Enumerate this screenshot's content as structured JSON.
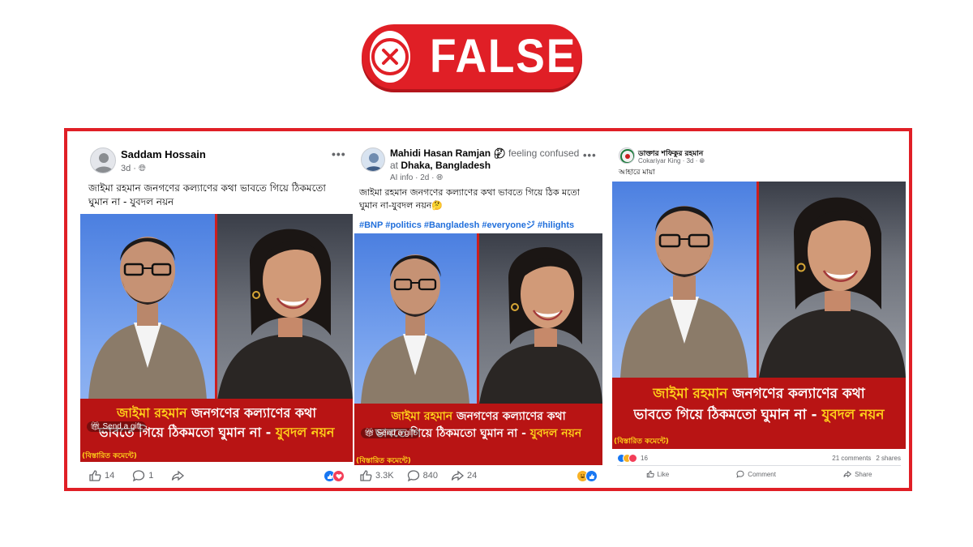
{
  "badge": {
    "label": "FALSE",
    "icon": "x-circle-icon",
    "color": "#e01f26"
  },
  "posts": [
    {
      "author": "Saddam Hossain",
      "time": "3d",
      "text": "জাইমা রহমান জনগণের কল্যাণের কথা ভাবতে গিয়ে ঠিকমতো ঘুমান না - যুবদল নয়ন",
      "caption_a": "জাইমা রহমান",
      "caption_b": " জনগণের কল্যাণের কথা",
      "caption_c": "ভাবতে গিয়ে ঠিকমতো ঘুমান না - ",
      "caption_d": "যুবদল নয়ন",
      "details": "(বিস্তারিত কমেন্টে)",
      "gift": "Send a gift",
      "likes": "14",
      "comments": "1"
    },
    {
      "author": "Mahidi Hasan Ramjan",
      "feeling": " feeling confused",
      "location_prefix": "at ",
      "location": "Dhaka, Bangladesh",
      "sub": "AI info",
      "time": "2d",
      "text": "জাইমা রহমান জনগণের কল্যাণের কথা ভাবতে  গিয়ে ঠিক মতো ঘুমান না-যুবদল নয়ন🤔",
      "tags": "#BNP #politics #Bangladesh #everyoneジ #hilights",
      "caption_a": "জাইমা রহমান",
      "caption_b": " জনগণের কল্যাণের কথা",
      "caption_c": "ভাবতে গিয়ে ঠিকমতো ঘুমান না - ",
      "caption_d": "যুবদল নয়ন",
      "details": "(বিস্তারিত কমেন্টে)",
      "gift": "Send a gift",
      "likes": "3.3K",
      "comments": "840",
      "shares": "24"
    },
    {
      "author": "ডাক্তার শফিকুর রহমান",
      "sub": "Cokariyar King",
      "time": "3d",
      "text": "আহারে মায়া",
      "caption_a": "জাইমা রহমান",
      "caption_b": " জনগণের কল্যাণের কথা",
      "caption_c": "ভাবতে গিয়ে ঠিকমতো ঘুমান না - ",
      "caption_d": "যুবদল নয়ন",
      "details": "(বিস্তারিত কমেন্টে)",
      "reaction_count": "16",
      "comments_label": "21 comments",
      "shares_label": "2 shares",
      "like_label": "Like",
      "comment_label": "Comment",
      "share_label": "Share"
    }
  ]
}
